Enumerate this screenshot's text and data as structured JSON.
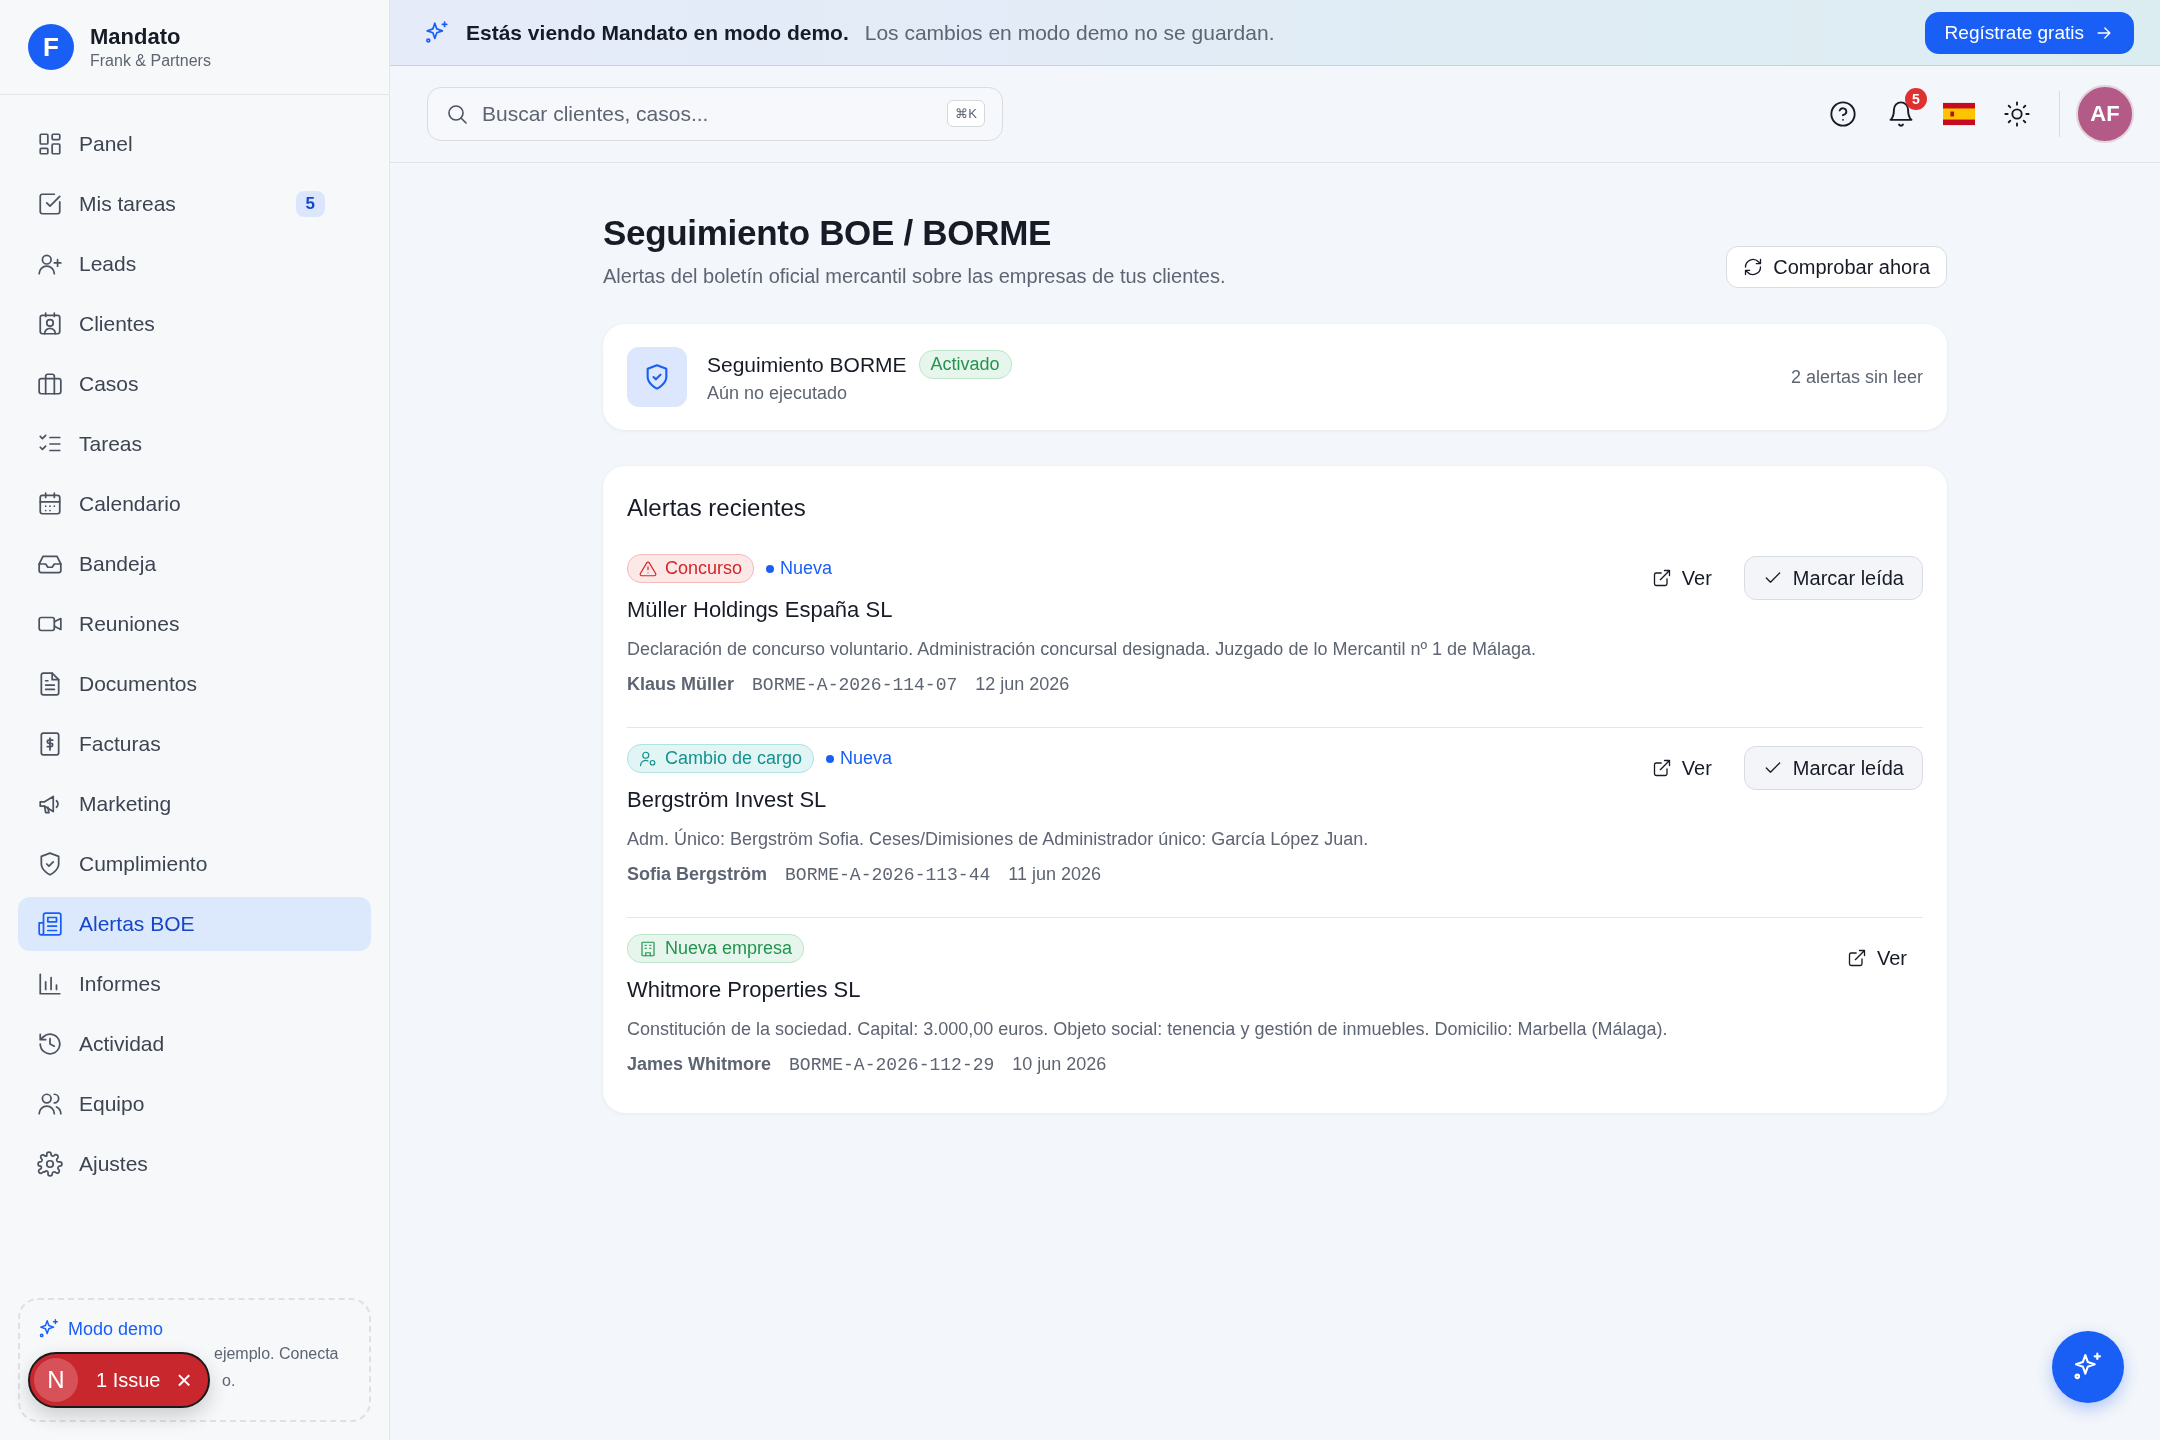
{
  "sidebar": {
    "logo_letter": "F",
    "app_name": "Mandato",
    "org_name": "Frank & Partners",
    "items": [
      {
        "label": "Panel",
        "selected": false
      },
      {
        "label": "Mis tareas",
        "selected": false,
        "badge": "5"
      },
      {
        "label": "Leads",
        "selected": false
      },
      {
        "label": "Clientes",
        "selected": false
      },
      {
        "label": "Casos",
        "selected": false
      },
      {
        "label": "Tareas",
        "selected": false
      },
      {
        "label": "Calendario",
        "selected": false
      },
      {
        "label": "Bandeja",
        "selected": false
      },
      {
        "label": "Reuniones",
        "selected": false
      },
      {
        "label": "Documentos",
        "selected": false
      },
      {
        "label": "Facturas",
        "selected": false
      },
      {
        "label": "Marketing",
        "selected": false
      },
      {
        "label": "Cumplimiento",
        "selected": false
      },
      {
        "label": "Alertas BOE",
        "selected": true
      },
      {
        "label": "Informes",
        "selected": false
      },
      {
        "label": "Actividad",
        "selected": false
      },
      {
        "label": "Equipo",
        "selected": false
      },
      {
        "label": "Ajustes",
        "selected": false
      }
    ],
    "demo_card": {
      "title": "Modo demo",
      "text_lines": [
        "ejemplo. Conecta",
        "o."
      ]
    },
    "issue_badge": {
      "letter": "N",
      "label": "1 Issue",
      "close": "×"
    }
  },
  "banner": {
    "title": "Estás viendo Mandato en modo demo.",
    "text": "Los cambios en modo demo no se guardan.",
    "button": "Regístrate gratis"
  },
  "topbar": {
    "search": {
      "placeholder": "Buscar clientes, casos...",
      "shortcut": "⌘K"
    },
    "notifications": "5",
    "avatar": "AF"
  },
  "page": {
    "title": "Seguimiento BOE / BORME",
    "subtitle": "Alertas del boletín oficial mercantil sobre las empresas de tus clientes.",
    "check_button": "Comprobar ahora",
    "monitor": {
      "name": "Seguimiento BORME",
      "status": "Activado",
      "last_run": "Aún no ejecutado",
      "unread": "2 alertas sin leer"
    },
    "alerts_title": "Alertas recientes",
    "alerts": [
      {
        "tag": {
          "label": "Concurso",
          "kind": "concurso"
        },
        "status": "Nueva",
        "company": "Müller Holdings España SL",
        "description": "Declaración de concurso voluntario. Administración concursal designada. Juzgado de lo Mercantil nº 1 de Málaga.",
        "person": "Klaus Müller",
        "reference": "BORME-A-2026-114-07",
        "date": "12 jun 2026",
        "actions": [
          "Ver",
          "Marcar leída"
        ]
      },
      {
        "tag": {
          "label": "Cambio de cargo",
          "kind": "cargo"
        },
        "status": "Nueva",
        "company": "Bergström Invest SL",
        "description": "Adm. Único: Bergström Sofia. Ceses/Dimisiones de Administrador único: García López Juan.",
        "person": "Sofia Bergström",
        "reference": "BORME-A-2026-113-44",
        "date": "11 jun 2026",
        "actions": [
          "Ver",
          "Marcar leída"
        ]
      },
      {
        "tag": {
          "label": "Nueva empresa",
          "kind": "empresa"
        },
        "company": "Whitmore Properties SL",
        "description": "Constitución de la sociedad. Capital: 3.000,00 euros. Objeto social: tenencia y gestión de inmuebles. Domicilio: Marbella (Málaga).",
        "person": "James Whitmore",
        "reference": "BORME-A-2026-112-29",
        "date": "10 jun 2026",
        "actions": [
          "Ver"
        ]
      }
    ]
  }
}
